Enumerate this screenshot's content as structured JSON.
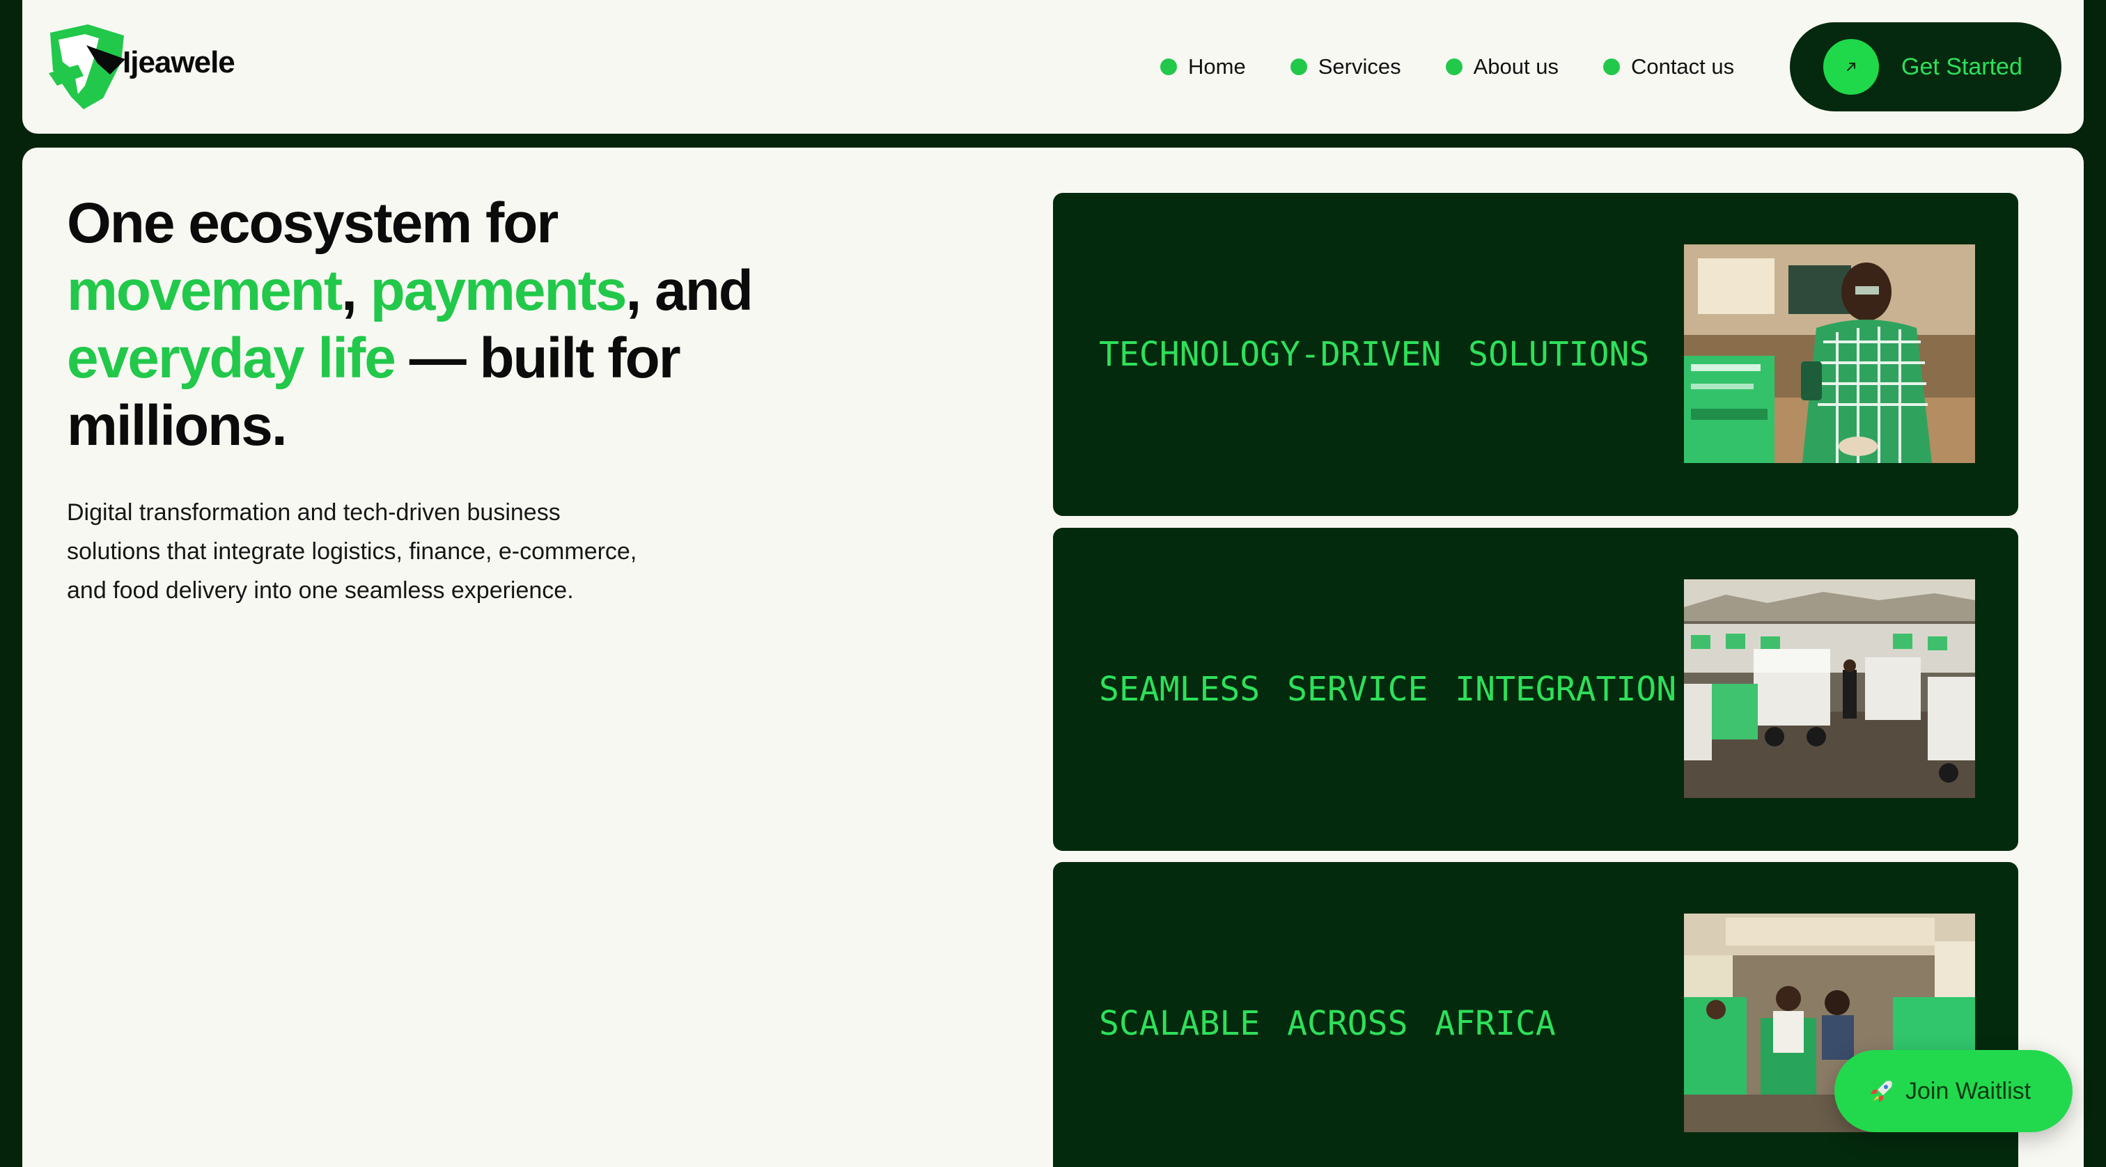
{
  "brand": {
    "name": "Ijeawele",
    "green": "#22c84a",
    "dark": "#042a0d",
    "light": "#f8f8f3"
  },
  "nav": {
    "items": [
      {
        "label": "Home"
      },
      {
        "label": "Services"
      },
      {
        "label": "About us"
      },
      {
        "label": "Contact us"
      }
    ],
    "cta": {
      "label": "Get Started",
      "icon": "arrow-up-right-icon"
    }
  },
  "hero": {
    "line1": "One ecosystem for",
    "word_movement": "movement",
    "comma1": ",",
    "word_payments": "payments",
    "and": ", and",
    "word_everyday": "everyday life",
    "built": "— built for",
    "millions": "millions.",
    "description": "Digital transformation and tech-driven business solutions that integrate logistics, finance, e-commerce, and food delivery into one seamless experience."
  },
  "cards": [
    {
      "title": "TECHNOLOGY-DRIVEN SOLUTIONS"
    },
    {
      "title": "SEAMLESS SERVICE INTEGRATION"
    },
    {
      "title": "SCALABLE ACROSS AFRICA"
    }
  ],
  "waitlist": {
    "label": "Join Waitlist",
    "icon": "rocket-icon"
  }
}
